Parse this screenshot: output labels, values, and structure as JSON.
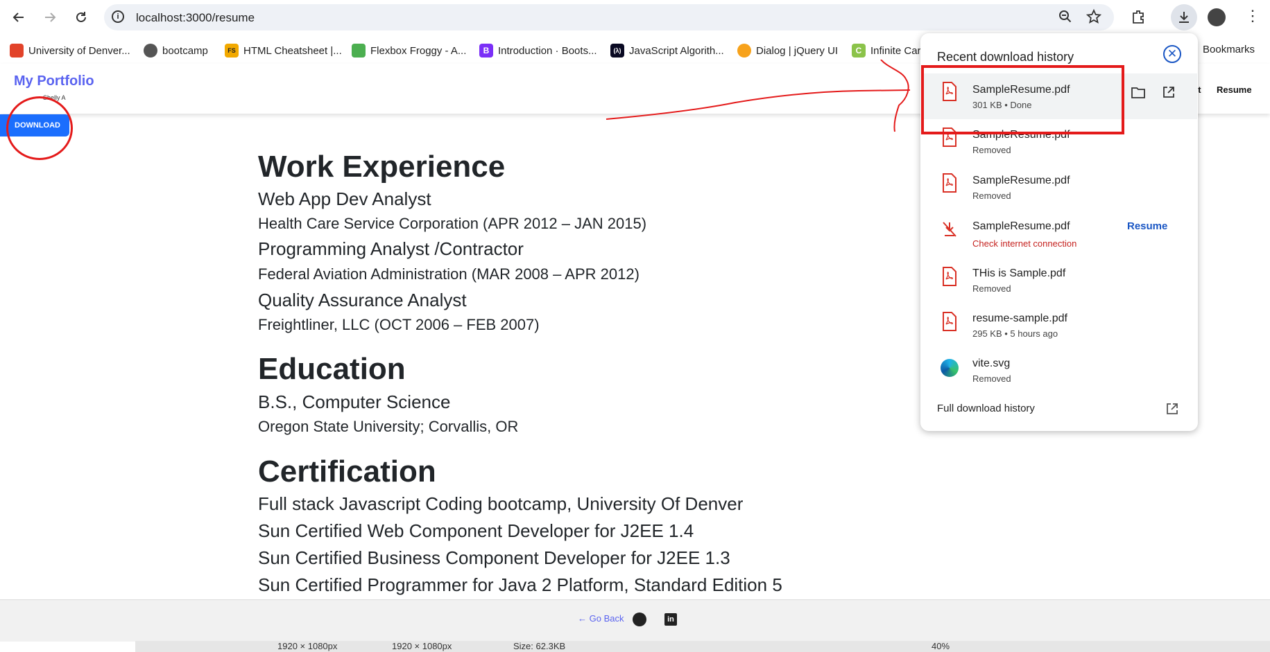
{
  "browser": {
    "url": "localhost:3000/resume",
    "bookmarks": [
      "University of Denver...",
      "bootcamp",
      "HTML Cheatsheet |...",
      "Flexbox Froggy - A...",
      "Introduction · Boots...",
      "JavaScript Algorith...",
      "Dialog | jQuery UI",
      "Infinite Car"
    ],
    "all_bookmarks": "Bookmarks"
  },
  "site": {
    "brand": "My Portfolio",
    "brand_sub": "Shelly A",
    "nav": [
      "ct",
      "Resume"
    ],
    "download_button": "DOWNLOAD"
  },
  "resume": {
    "work_heading": "Work Experience",
    "jobs": [
      {
        "title": "Web App Dev Analyst",
        "org": "Health Care Service Corporation (APR 2012 – JAN 2015)"
      },
      {
        "title": "Programming Analyst /Contractor",
        "org": "Federal Aviation Administration (MAR 2008 – APR 2012)"
      },
      {
        "title": "Quality Assurance Analyst",
        "org": "Freightliner, LLC (OCT 2006 – FEB 2007)"
      }
    ],
    "education_heading": "Education",
    "degree": "B.S., Computer Science",
    "school": "Oregon State University; Corvallis, OR",
    "cert_heading": "Certification",
    "certs": [
      "Full stack Javascript Coding bootcamp, University Of Denver",
      "Sun Certified Web Component Developer for J2EE 1.4",
      "Sun Certified Business Component Developer for J2EE 1.3",
      "Sun Certified Programmer for Java 2 Platform, Standard Edition 5"
    ]
  },
  "footer": {
    "go_back": "← Go Back"
  },
  "taskbar": {
    "items": [
      "1920 × 1080px",
      "1920 × 1080px",
      "Size: 62.3KB",
      "40%"
    ]
  },
  "downloads": {
    "title": "Recent download history",
    "items": [
      {
        "name": "SampleResume.pdf",
        "status": "301 KB • Done"
      },
      {
        "name": "SampleResume.pdf",
        "status": "Removed"
      },
      {
        "name": "SampleResume.pdf",
        "status": "Removed"
      },
      {
        "name": "SampleResume.pdf",
        "status": "Check internet connection"
      },
      {
        "name": "THis is Sample.pdf",
        "status": "Removed"
      },
      {
        "name": "resume-sample.pdf",
        "status": "295 KB • 5 hours ago"
      },
      {
        "name": "vite.svg",
        "status": "Removed"
      }
    ],
    "resume_label": "Resume",
    "full_history": "Full download history"
  }
}
